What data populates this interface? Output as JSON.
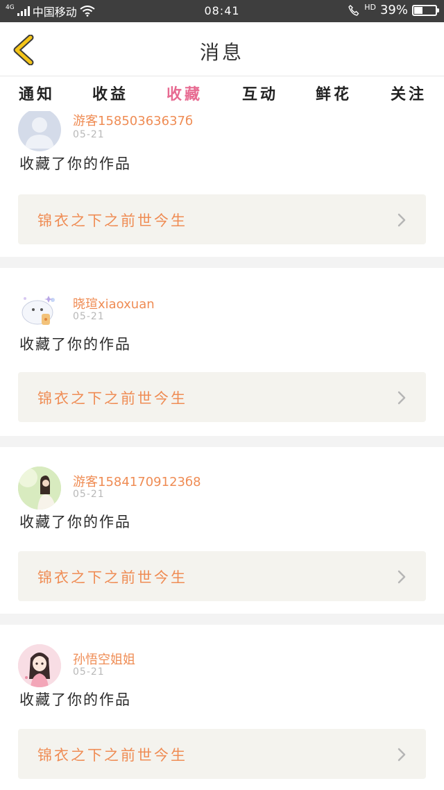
{
  "status_bar": {
    "network": "4G",
    "carrier": "中国移动",
    "time": "08:41",
    "hd": "HD",
    "battery_percent": "39%",
    "battery_level": 0.39,
    "icon_signal": "signal-icon",
    "icon_wifi": "wifi-icon",
    "icon_call": "call-icon",
    "icon_battery": "battery-icon"
  },
  "header": {
    "title": "消息",
    "back_icon": "chevron-left-icon",
    "back_color": "#f5c518"
  },
  "tabs": [
    {
      "label": "通知"
    },
    {
      "label": "收益"
    },
    {
      "label": "收藏",
      "active": true
    },
    {
      "label": "互动"
    },
    {
      "label": "鲜花"
    },
    {
      "label": "关注"
    }
  ],
  "accent_color": "#e76a91",
  "name_color": "#ef8c54",
  "items": [
    {
      "user": "游客15850363637б",
      "date": "05-21",
      "action": "收藏了你的作品",
      "work_title": "锦衣之下之前世今生"
    },
    {
      "user": "晓瑄xiaoxuan",
      "date": "05-21",
      "action": "收藏了你的作品",
      "work_title": "锦衣之下之前世今生"
    },
    {
      "user": "游客15841709123б8",
      "date": "05-21",
      "action": "收藏了你的作品",
      "work_title": "锦衣之下之前世今生"
    },
    {
      "user": "孙悟空姐姐",
      "date": "05-21",
      "action": "收藏了你的作品",
      "work_title": "锦衣之下之前世今生"
    }
  ]
}
